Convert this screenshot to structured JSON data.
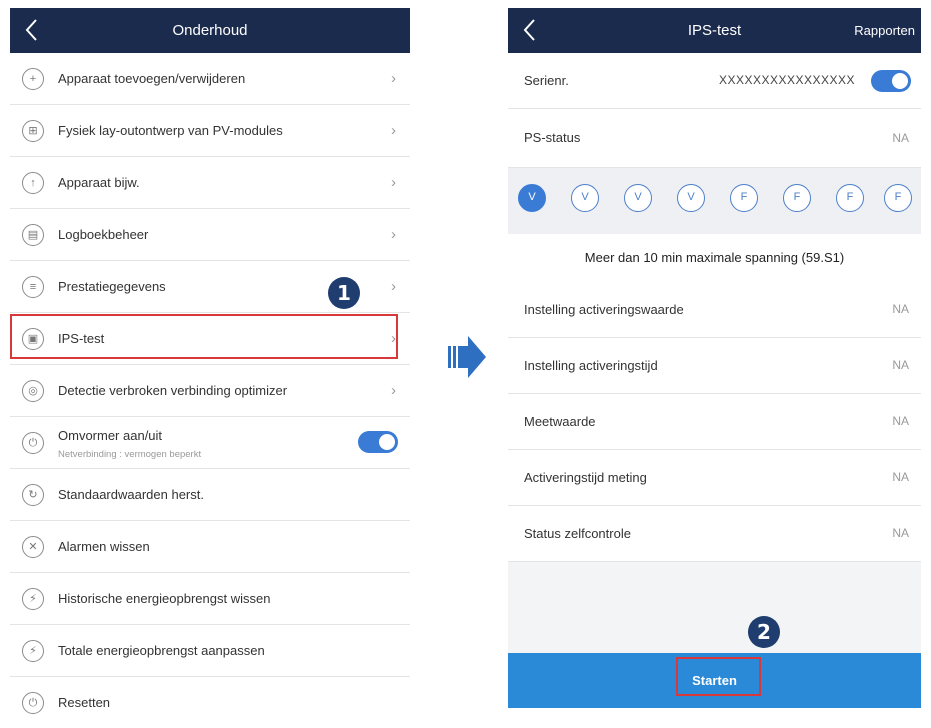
{
  "left": {
    "title": "Onderhoud",
    "items": [
      {
        "label": "Apparaat toevoegen/verwijderen",
        "icon": "plus-icon",
        "glyph": "+"
      },
      {
        "label": "Fysiek lay-outontwerp van PV-modules",
        "icon": "layout-icon",
        "glyph": "⊞"
      },
      {
        "label": "Apparaat bijw.",
        "icon": "upgrade-icon",
        "glyph": "↑"
      },
      {
        "label": "Logboekbeheer",
        "icon": "log-icon",
        "glyph": "▤"
      },
      {
        "label": "Prestatiegegevens",
        "icon": "performance-icon",
        "glyph": "≡"
      },
      {
        "label": "IPS-test",
        "icon": "ips-test-icon",
        "glyph": "▣"
      },
      {
        "label": "Detectie verbroken verbinding optimizer",
        "icon": "optimizer-icon",
        "glyph": "◎"
      }
    ],
    "inverter": {
      "label": "Omvormer aan/uit",
      "sub": "Netverbinding : vermogen beperkt",
      "glyph": "⏻"
    },
    "items2": [
      {
        "label": "Standaardwaarden herst.",
        "icon": "reset-defaults-icon",
        "glyph": "↻"
      },
      {
        "label": "Alarmen wissen",
        "icon": "clear-alarm-icon",
        "glyph": "✕"
      },
      {
        "label": "Historische energieopbrengst wissen",
        "icon": "clear-history-icon",
        "glyph": "⚡"
      },
      {
        "label": "Totale energieopbrengst aanpassen",
        "icon": "adjust-energy-icon",
        "glyph": "⚡"
      },
      {
        "label": "Resetten",
        "icon": "reset-icon",
        "glyph": "⏻"
      }
    ],
    "step1": "1"
  },
  "right": {
    "title": "IPS-test",
    "action": "Rapporten",
    "serial_label": "Serienr.",
    "serial_value": "XXXXXXXXXXXXXXXX",
    "ps_status_label": "PS-status",
    "ps_status_value": "NA",
    "voltage_icons": [
      "V",
      "V",
      "V",
      "V",
      "F",
      "F",
      "F",
      "F"
    ],
    "description": "Meer dan 10 min maximale spanning (59.S1)",
    "rows": [
      {
        "label": "Instelling activeringswaarde",
        "value": "NA"
      },
      {
        "label": "Instelling activeringstijd",
        "value": "NA"
      },
      {
        "label": "Meetwaarde",
        "value": "NA"
      },
      {
        "label": "Activeringstijd meting",
        "value": "NA"
      },
      {
        "label": "Status zelfcontrole",
        "value": "NA"
      }
    ],
    "start_label": "Starten",
    "step2": "2"
  },
  "colors": {
    "header": "#1b2b4e",
    "accent": "#3a7bd5",
    "highlight": "#d9383a",
    "start_bar": "#2a8ad8"
  }
}
